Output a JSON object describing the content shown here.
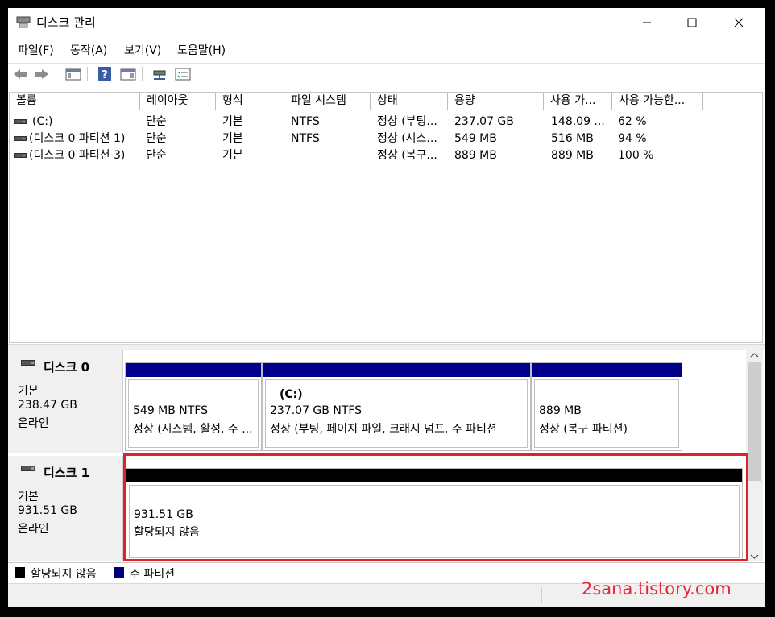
{
  "window": {
    "title": "디스크 관리"
  },
  "menu": [
    "파일(F)",
    "동작(A)",
    "보기(V)",
    "도움말(H)"
  ],
  "columns": [
    "볼륨",
    "레이아웃",
    "형식",
    "파일 시스템",
    "상태",
    "용량",
    "사용 가...",
    "사용 가능한..."
  ],
  "volumes": [
    {
      "name": "(C:)",
      "layout": "단순",
      "type": "기본",
      "fs": "NTFS",
      "status": "정상 (부팅...",
      "capacity": "237.07 GB",
      "free": "148.09 ...",
      "pct": "62 %"
    },
    {
      "name": "(디스크 0 파티션 1)",
      "layout": "단순",
      "type": "기본",
      "fs": "NTFS",
      "status": "정상 (시스...",
      "capacity": "549 MB",
      "free": "516 MB",
      "pct": "94 %"
    },
    {
      "name": "(디스크 0 파티션 3)",
      "layout": "단순",
      "type": "기본",
      "fs": "",
      "status": "정상 (복구...",
      "capacity": "889 MB",
      "free": "889 MB",
      "pct": "100 %"
    }
  ],
  "disks": [
    {
      "name": "디스크 0",
      "type": "기본",
      "size": "238.47 GB",
      "state": "온라인",
      "partitions": [
        {
          "label": "",
          "size": "549 MB NTFS",
          "status": "정상 (시스템, 활성, 주 ..."
        },
        {
          "label": "(C:)",
          "size": "237.07 GB NTFS",
          "status": "정상 (부팅, 페이지 파일, 크래시 덤프, 주 파티션"
        },
        {
          "label": "",
          "size": "889 MB",
          "status": "정상 (복구 파티션)"
        }
      ]
    },
    {
      "name": "디스크 1",
      "type": "기본",
      "size": "931.51 GB",
      "state": "온라인",
      "partitions": [
        {
          "size": "931.51 GB",
          "status": "할당되지 않음"
        }
      ]
    }
  ],
  "legend": [
    {
      "label": "할당되지 않음",
      "color": "#000000"
    },
    {
      "label": "주 파티션",
      "color": "#00007f"
    }
  ],
  "colors": {
    "primary_partition": "#00008b",
    "unallocated": "#000000",
    "highlight": "#e0202a"
  },
  "watermark": "2sana.tistory.com"
}
